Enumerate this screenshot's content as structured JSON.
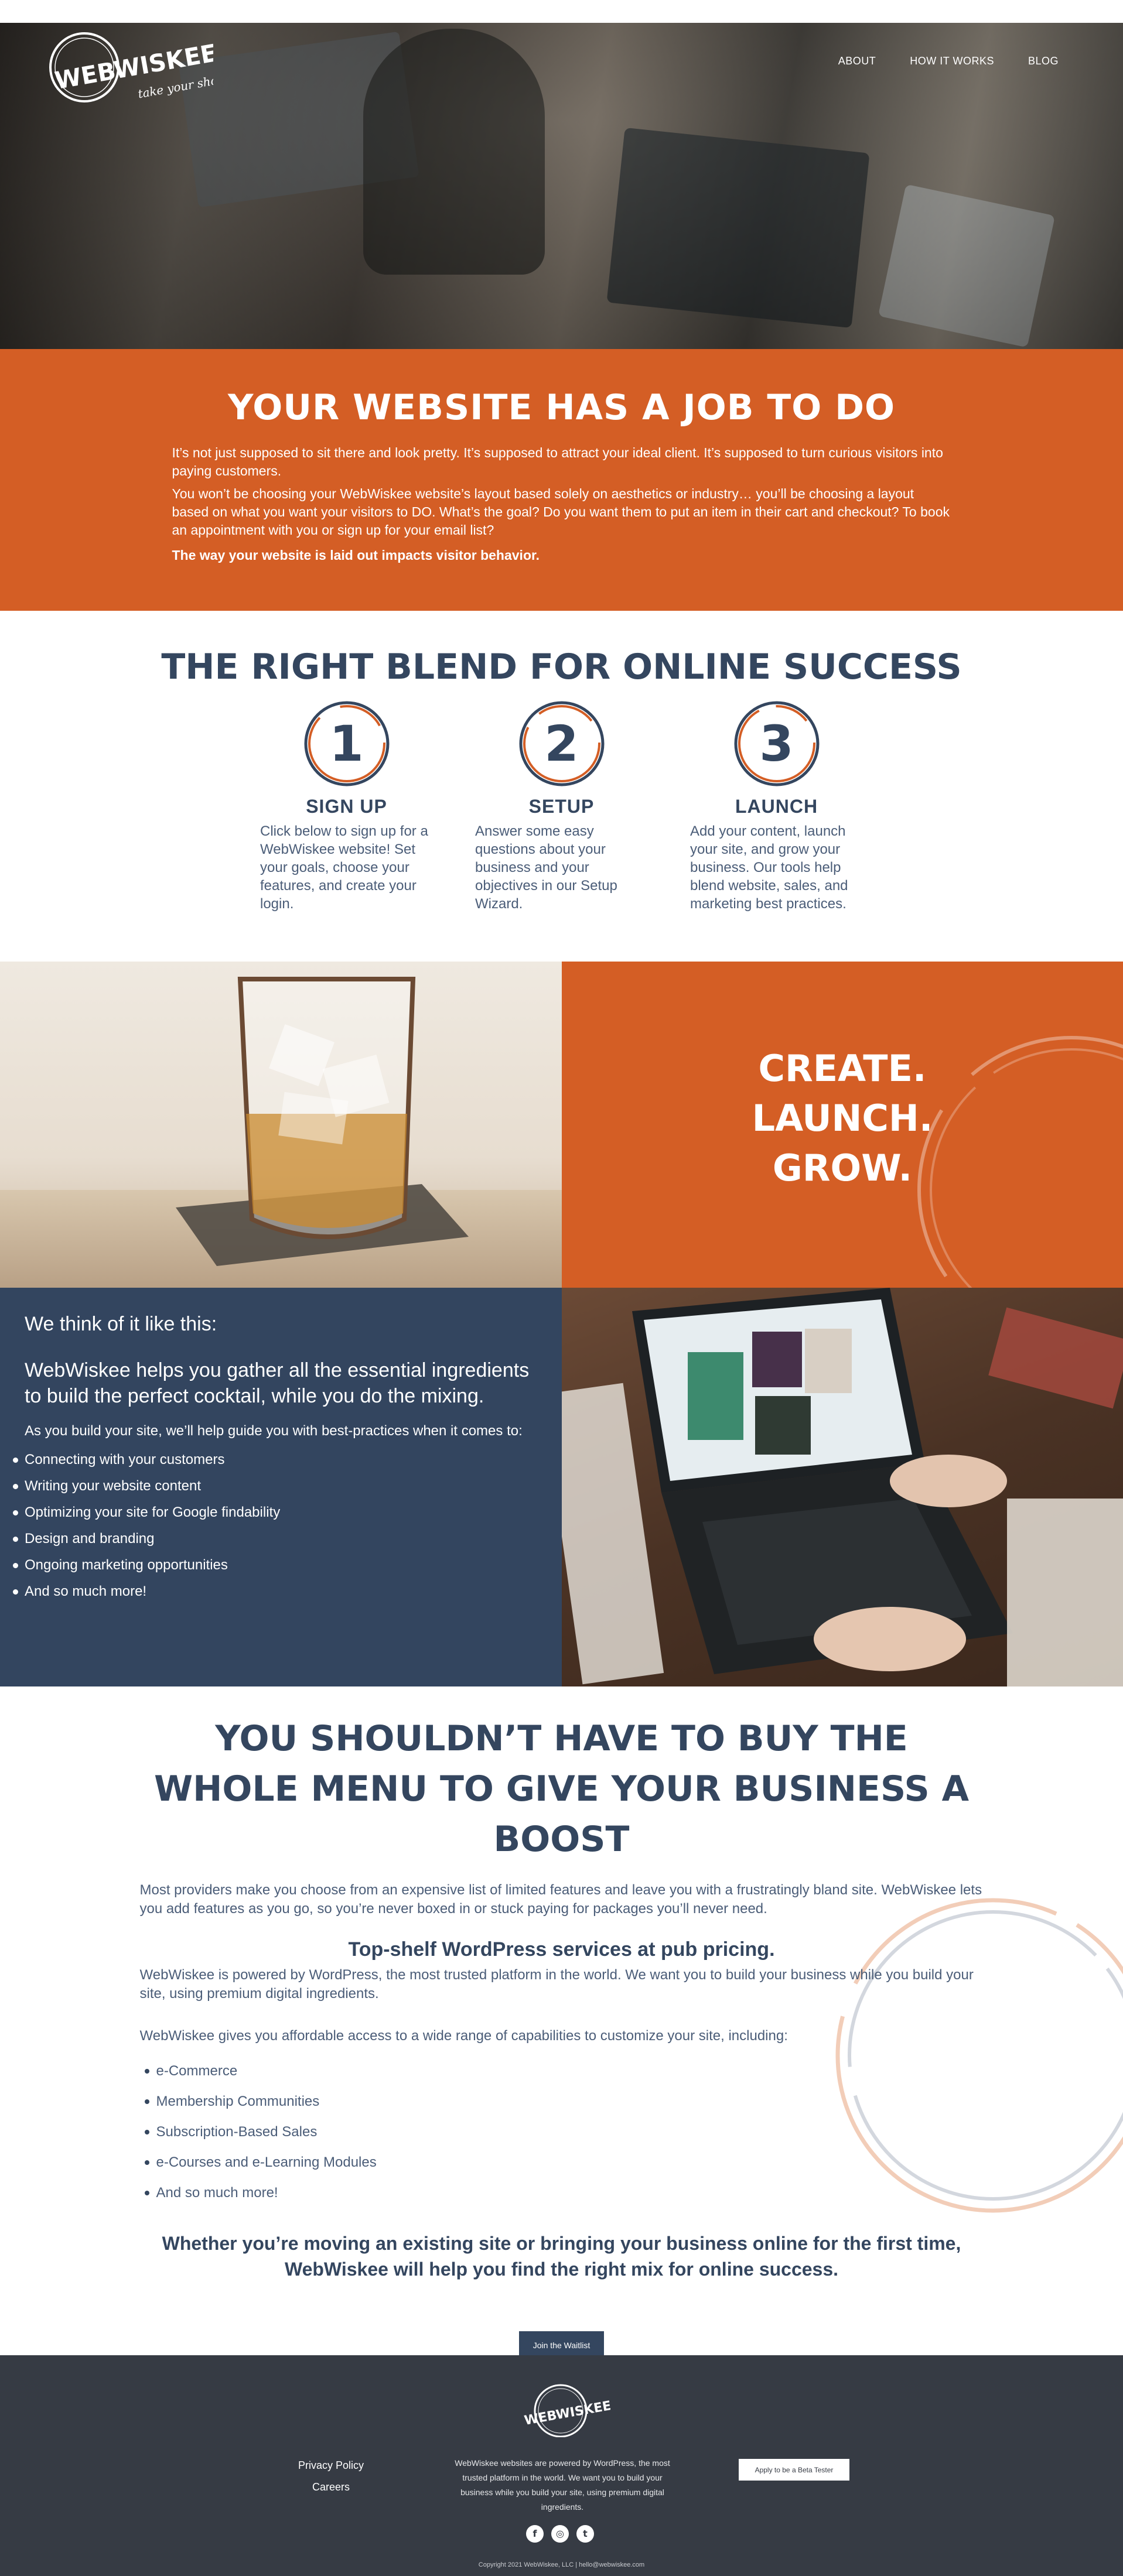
{
  "header": {
    "logo_text": "WEBWISKEE",
    "logo_tagline": "take your shot",
    "nav": [
      "ABOUT",
      "HOW IT WORKS",
      "BLOG"
    ]
  },
  "job": {
    "title": "YOUR WEBSITE HAS A JOB TO DO",
    "p1": "It’s not just supposed to sit there and look pretty. It’s supposed to attract your ideal client. It’s supposed to turn curious visitors into paying customers.",
    "p2": "You won’t be choosing your WebWiskee website’s layout based solely on aesthetics or industry… you’ll be choosing a layout based on what you want your visitors to DO. What’s the goal? Do you want them to put an item in their cart and checkout? To book an appointment with you or sign up for your email list?",
    "p3": "The way your website is laid out impacts visitor behavior."
  },
  "blend": {
    "title": "THE RIGHT BLEND FOR ONLINE SUCCESS",
    "steps": [
      {
        "number": "1",
        "title": "SIGN UP",
        "text": "Click below to sign up for a WebWiskee website! Set your goals, choose your features, and create your login."
      },
      {
        "number": "2",
        "title": "SETUP",
        "text": "Answer some easy questions about your business and your objectives in our Setup Wizard."
      },
      {
        "number": "3",
        "title": "LAUNCH",
        "text": "Add your content, launch your site, and grow your business. Our tools help blend website, sales, and marketing best practices."
      }
    ]
  },
  "create": {
    "words": [
      "CREATE.",
      "LAUNCH.",
      "GROW."
    ]
  },
  "cocktail": {
    "lead": "We think of it like this:",
    "big": "WebWiskee helps you gather all the essential ingredients to build the perfect cocktail, while you do the mixing.",
    "intro": "As you build your site, we’ll help guide you with best-practices when it comes to:",
    "items": [
      "Connecting with your customers",
      "Writing your website content",
      "Optimizing your site for Google findability",
      "Design and branding",
      "Ongoing marketing opportunities",
      "And so much more!"
    ]
  },
  "menu": {
    "title": "YOU SHOULDN’T HAVE TO BUY THE WHOLE MENU TO GIVE YOUR BUSINESS A BOOST",
    "p1": "Most providers make you choose from an expensive list of limited features and leave you with a frustratingly bland site. WebWiskee lets you add features as you go, so you’re never boxed in or stuck paying for packages you’ll never need.",
    "subtitle": "Top-shelf WordPress services at pub pricing.",
    "p2": "WebWiskee is powered by WordPress, the most trusted platform in the world. We want you to build your business while you build your site, using premium digital ingredients.",
    "p3": "WebWiskee gives you affordable access to a wide range of capabilities to customize your site, including:",
    "items": [
      "e-Commerce",
      "Membership Communities",
      "Subscription-Based Sales",
      "e-Courses and e-Learning Modules",
      "And so much more!"
    ],
    "closing": "Whether you’re moving an existing site or bringing your business online for the first time, WebWiskee will help you find the right mix for online success.",
    "button": "Join the Waitlist"
  },
  "footer": {
    "logo_text": "WEBWISKEE",
    "links": [
      "Privacy Policy",
      "Careers"
    ],
    "about": "WebWiskee websites are powered by WordPress, the most trusted platform in the world. We want you to build your business while you build your site, using premium digital ingredients.",
    "beta_button": "Apply to be a Beta Tester",
    "social": [
      "f",
      "◎",
      "t"
    ],
    "copyright": "Copyright 2021 WebWiskee, LLC  |  hello@webwiskee.com"
  },
  "colors": {
    "orange": "#d45e25",
    "navy": "#33455f",
    "footer": "#363b44"
  }
}
